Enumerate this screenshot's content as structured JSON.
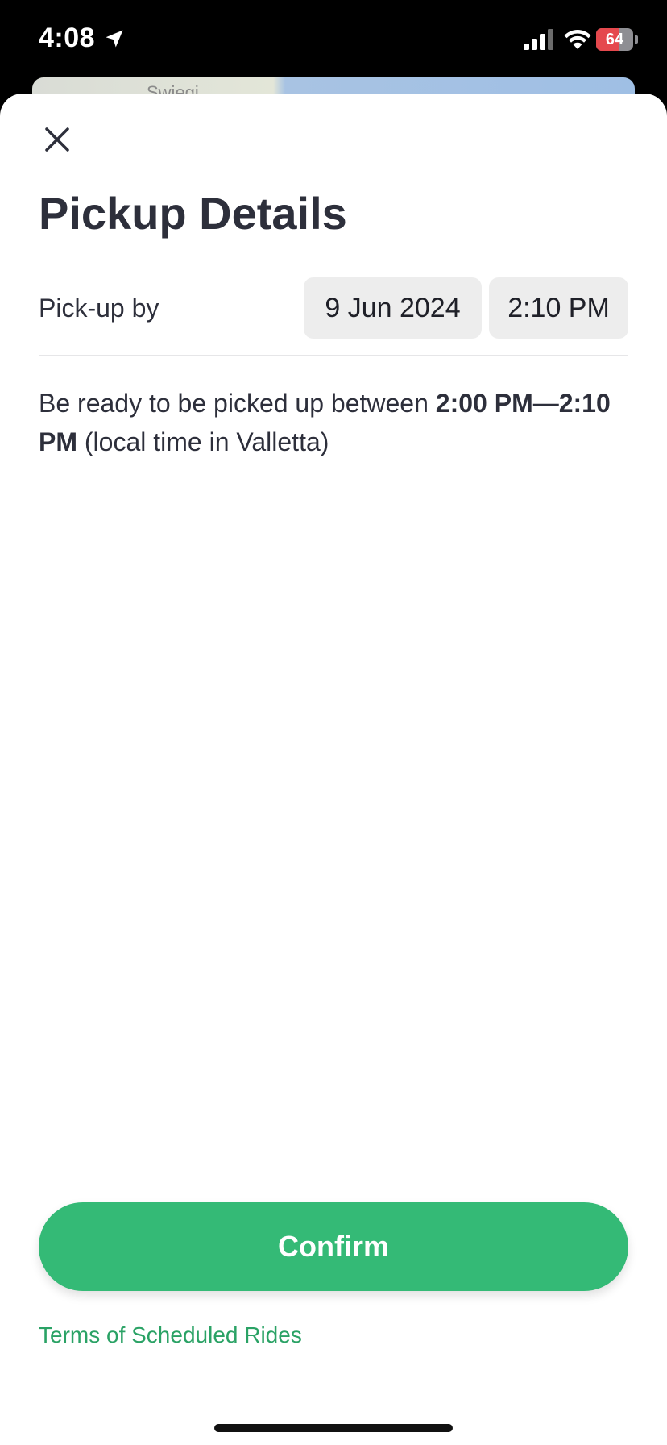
{
  "status_bar": {
    "time": "4:08",
    "battery_level": "64",
    "battery_percent": 64,
    "battery_color": "#e5484d"
  },
  "map": {
    "label": "Swiegi"
  },
  "sheet": {
    "title": "Pickup Details",
    "pickup": {
      "label": "Pick-up by",
      "date": "9 Jun 2024",
      "time": "2:10 PM"
    },
    "ready": {
      "prefix": "Be ready to be picked up between ",
      "window": "2:00 PM—2:10 PM",
      "suffix": " (local time in Valletta)"
    },
    "confirm_label": "Confirm",
    "terms_label": "Terms of Scheduled Rides"
  },
  "colors": {
    "accent": "#34ba76",
    "link": "#2aa265",
    "text": "#2d2f3b",
    "chip_bg": "#ededed"
  },
  "icons": {
    "close": "close-icon",
    "location": "location-arrow-icon",
    "signal": "cellular-signal-icon",
    "wifi": "wifi-icon",
    "battery": "battery-charging-icon"
  }
}
